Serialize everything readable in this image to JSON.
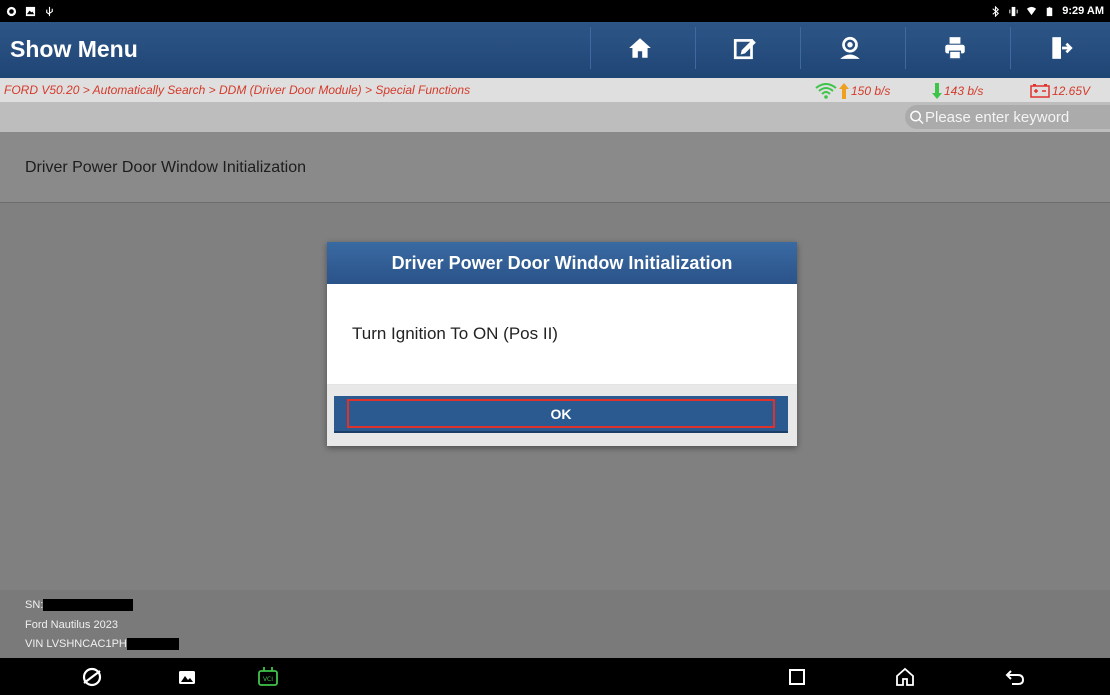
{
  "status_bar": {
    "time": "9:29 AM",
    "left_icons": [
      "app-icon",
      "image-icon",
      "usb-icon"
    ],
    "right_icons": [
      "bluetooth-icon",
      "vibrate-icon",
      "wifi-icon",
      "battery-icon"
    ]
  },
  "header": {
    "title": "Show Menu",
    "buttons": [
      "home-icon",
      "edit-report-icon",
      "user-icon",
      "print-icon",
      "exit-icon"
    ]
  },
  "breadcrumb": "FORD V50.20 > Automatically Search > DDM (Driver Door Module) > Special Functions",
  "connection": {
    "upload": "150 b/s",
    "download": "143 b/s",
    "battery_voltage": "12.65V"
  },
  "search": {
    "placeholder": "Please enter keyword"
  },
  "list": {
    "items": [
      "Driver Power Door Window Initialization"
    ]
  },
  "dialog": {
    "title": "Driver Power Door Window Initialization",
    "message": "Turn Ignition To ON (Pos II)",
    "ok_label": "OK"
  },
  "footer": {
    "sn_label": "SN:",
    "vehicle": "Ford Nautilus 2023",
    "vin_label": "VIN LVSHNCAC1PH"
  },
  "colors": {
    "header": "#2d5687",
    "breadcrumb_text": "#d43a2a",
    "ok_button": "#2b5a90",
    "highlight": "#e0322d",
    "vci_icon": "#3fc44a"
  }
}
